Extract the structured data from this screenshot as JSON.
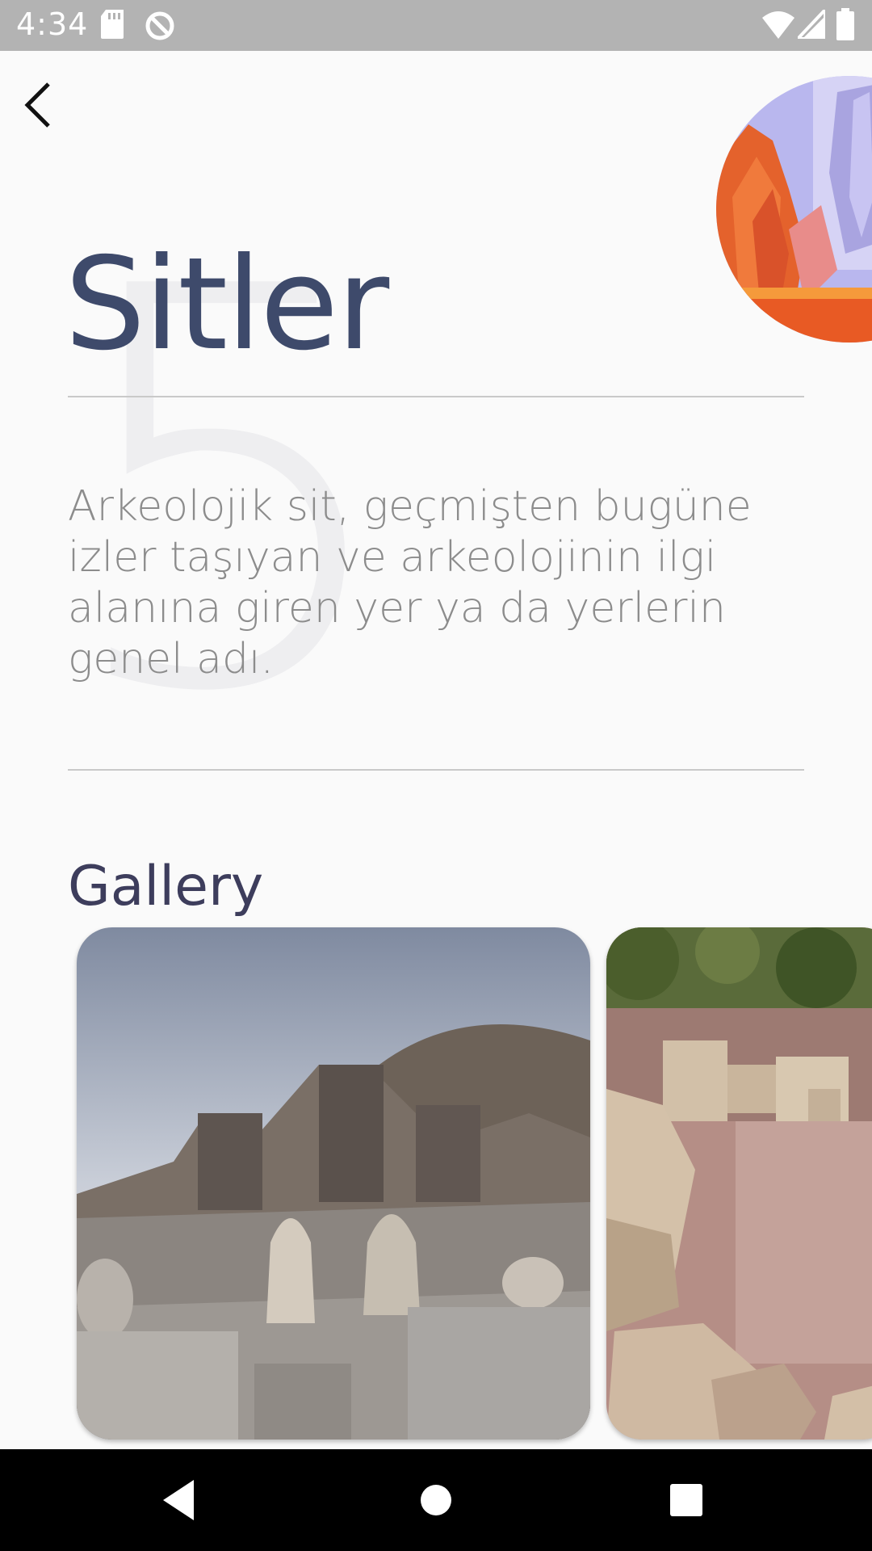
{
  "status_bar": {
    "time": "4:34",
    "icons": [
      "sd-card-icon",
      "data-saver-icon",
      "wifi-icon",
      "signal-icon",
      "battery-icon"
    ]
  },
  "header": {
    "back_icon": "chevron-left-icon"
  },
  "page": {
    "background_number": "5",
    "title": "Sitler",
    "description": "Arkeolojik sit, geçmişten bugüne izler taşıyan ve arkeolojinin ilgi alanına giren yer ya da yerlerin genel adı.",
    "gallery_title": "Gallery"
  },
  "colors": {
    "title": "#3e4a6b",
    "description": "#8c8c8c",
    "background": "#fafafa",
    "status_bar": "#b3b3b3"
  },
  "nav_bar": {
    "icons": [
      "back-triangle-icon",
      "home-circle-icon",
      "recents-square-icon"
    ]
  }
}
